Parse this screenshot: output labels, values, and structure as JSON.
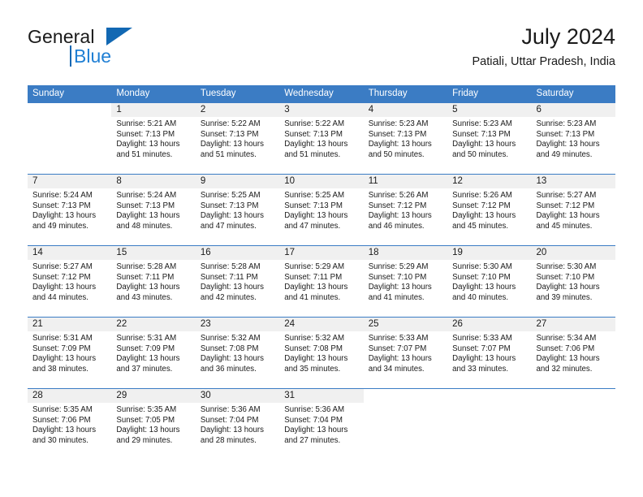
{
  "logo": {
    "primary_text": "General",
    "secondary_text": "Blue",
    "accent_color": "#1268b3",
    "secondary_color": "#1f7fd4",
    "triangle_icon": "triangle-icon"
  },
  "header": {
    "title": "July 2024",
    "subtitle": "Patiali, Uttar Pradesh, India"
  },
  "calendar": {
    "header_color": "#3b7cc4",
    "daynum_band_color": "#f0f0f0",
    "weekdays": [
      "Sunday",
      "Monday",
      "Tuesday",
      "Wednesday",
      "Thursday",
      "Friday",
      "Saturday"
    ],
    "weeks": [
      [
        {
          "day": "",
          "sunrise": "",
          "sunset": "",
          "daylight_line1": "",
          "daylight_line2": ""
        },
        {
          "day": "1",
          "sunrise": "Sunrise: 5:21 AM",
          "sunset": "Sunset: 7:13 PM",
          "daylight_line1": "Daylight: 13 hours",
          "daylight_line2": "and 51 minutes."
        },
        {
          "day": "2",
          "sunrise": "Sunrise: 5:22 AM",
          "sunset": "Sunset: 7:13 PM",
          "daylight_line1": "Daylight: 13 hours",
          "daylight_line2": "and 51 minutes."
        },
        {
          "day": "3",
          "sunrise": "Sunrise: 5:22 AM",
          "sunset": "Sunset: 7:13 PM",
          "daylight_line1": "Daylight: 13 hours",
          "daylight_line2": "and 51 minutes."
        },
        {
          "day": "4",
          "sunrise": "Sunrise: 5:23 AM",
          "sunset": "Sunset: 7:13 PM",
          "daylight_line1": "Daylight: 13 hours",
          "daylight_line2": "and 50 minutes."
        },
        {
          "day": "5",
          "sunrise": "Sunrise: 5:23 AM",
          "sunset": "Sunset: 7:13 PM",
          "daylight_line1": "Daylight: 13 hours",
          "daylight_line2": "and 50 minutes."
        },
        {
          "day": "6",
          "sunrise": "Sunrise: 5:23 AM",
          "sunset": "Sunset: 7:13 PM",
          "daylight_line1": "Daylight: 13 hours",
          "daylight_line2": "and 49 minutes."
        }
      ],
      [
        {
          "day": "7",
          "sunrise": "Sunrise: 5:24 AM",
          "sunset": "Sunset: 7:13 PM",
          "daylight_line1": "Daylight: 13 hours",
          "daylight_line2": "and 49 minutes."
        },
        {
          "day": "8",
          "sunrise": "Sunrise: 5:24 AM",
          "sunset": "Sunset: 7:13 PM",
          "daylight_line1": "Daylight: 13 hours",
          "daylight_line2": "and 48 minutes."
        },
        {
          "day": "9",
          "sunrise": "Sunrise: 5:25 AM",
          "sunset": "Sunset: 7:13 PM",
          "daylight_line1": "Daylight: 13 hours",
          "daylight_line2": "and 47 minutes."
        },
        {
          "day": "10",
          "sunrise": "Sunrise: 5:25 AM",
          "sunset": "Sunset: 7:13 PM",
          "daylight_line1": "Daylight: 13 hours",
          "daylight_line2": "and 47 minutes."
        },
        {
          "day": "11",
          "sunrise": "Sunrise: 5:26 AM",
          "sunset": "Sunset: 7:12 PM",
          "daylight_line1": "Daylight: 13 hours",
          "daylight_line2": "and 46 minutes."
        },
        {
          "day": "12",
          "sunrise": "Sunrise: 5:26 AM",
          "sunset": "Sunset: 7:12 PM",
          "daylight_line1": "Daylight: 13 hours",
          "daylight_line2": "and 45 minutes."
        },
        {
          "day": "13",
          "sunrise": "Sunrise: 5:27 AM",
          "sunset": "Sunset: 7:12 PM",
          "daylight_line1": "Daylight: 13 hours",
          "daylight_line2": "and 45 minutes."
        }
      ],
      [
        {
          "day": "14",
          "sunrise": "Sunrise: 5:27 AM",
          "sunset": "Sunset: 7:12 PM",
          "daylight_line1": "Daylight: 13 hours",
          "daylight_line2": "and 44 minutes."
        },
        {
          "day": "15",
          "sunrise": "Sunrise: 5:28 AM",
          "sunset": "Sunset: 7:11 PM",
          "daylight_line1": "Daylight: 13 hours",
          "daylight_line2": "and 43 minutes."
        },
        {
          "day": "16",
          "sunrise": "Sunrise: 5:28 AM",
          "sunset": "Sunset: 7:11 PM",
          "daylight_line1": "Daylight: 13 hours",
          "daylight_line2": "and 42 minutes."
        },
        {
          "day": "17",
          "sunrise": "Sunrise: 5:29 AM",
          "sunset": "Sunset: 7:11 PM",
          "daylight_line1": "Daylight: 13 hours",
          "daylight_line2": "and 41 minutes."
        },
        {
          "day": "18",
          "sunrise": "Sunrise: 5:29 AM",
          "sunset": "Sunset: 7:10 PM",
          "daylight_line1": "Daylight: 13 hours",
          "daylight_line2": "and 41 minutes."
        },
        {
          "day": "19",
          "sunrise": "Sunrise: 5:30 AM",
          "sunset": "Sunset: 7:10 PM",
          "daylight_line1": "Daylight: 13 hours",
          "daylight_line2": "and 40 minutes."
        },
        {
          "day": "20",
          "sunrise": "Sunrise: 5:30 AM",
          "sunset": "Sunset: 7:10 PM",
          "daylight_line1": "Daylight: 13 hours",
          "daylight_line2": "and 39 minutes."
        }
      ],
      [
        {
          "day": "21",
          "sunrise": "Sunrise: 5:31 AM",
          "sunset": "Sunset: 7:09 PM",
          "daylight_line1": "Daylight: 13 hours",
          "daylight_line2": "and 38 minutes."
        },
        {
          "day": "22",
          "sunrise": "Sunrise: 5:31 AM",
          "sunset": "Sunset: 7:09 PM",
          "daylight_line1": "Daylight: 13 hours",
          "daylight_line2": "and 37 minutes."
        },
        {
          "day": "23",
          "sunrise": "Sunrise: 5:32 AM",
          "sunset": "Sunset: 7:08 PM",
          "daylight_line1": "Daylight: 13 hours",
          "daylight_line2": "and 36 minutes."
        },
        {
          "day": "24",
          "sunrise": "Sunrise: 5:32 AM",
          "sunset": "Sunset: 7:08 PM",
          "daylight_line1": "Daylight: 13 hours",
          "daylight_line2": "and 35 minutes."
        },
        {
          "day": "25",
          "sunrise": "Sunrise: 5:33 AM",
          "sunset": "Sunset: 7:07 PM",
          "daylight_line1": "Daylight: 13 hours",
          "daylight_line2": "and 34 minutes."
        },
        {
          "day": "26",
          "sunrise": "Sunrise: 5:33 AM",
          "sunset": "Sunset: 7:07 PM",
          "daylight_line1": "Daylight: 13 hours",
          "daylight_line2": "and 33 minutes."
        },
        {
          "day": "27",
          "sunrise": "Sunrise: 5:34 AM",
          "sunset": "Sunset: 7:06 PM",
          "daylight_line1": "Daylight: 13 hours",
          "daylight_line2": "and 32 minutes."
        }
      ],
      [
        {
          "day": "28",
          "sunrise": "Sunrise: 5:35 AM",
          "sunset": "Sunset: 7:06 PM",
          "daylight_line1": "Daylight: 13 hours",
          "daylight_line2": "and 30 minutes."
        },
        {
          "day": "29",
          "sunrise": "Sunrise: 5:35 AM",
          "sunset": "Sunset: 7:05 PM",
          "daylight_line1": "Daylight: 13 hours",
          "daylight_line2": "and 29 minutes."
        },
        {
          "day": "30",
          "sunrise": "Sunrise: 5:36 AM",
          "sunset": "Sunset: 7:04 PM",
          "daylight_line1": "Daylight: 13 hours",
          "daylight_line2": "and 28 minutes."
        },
        {
          "day": "31",
          "sunrise": "Sunrise: 5:36 AM",
          "sunset": "Sunset: 7:04 PM",
          "daylight_line1": "Daylight: 13 hours",
          "daylight_line2": "and 27 minutes."
        },
        {
          "day": "",
          "sunrise": "",
          "sunset": "",
          "daylight_line1": "",
          "daylight_line2": ""
        },
        {
          "day": "",
          "sunrise": "",
          "sunset": "",
          "daylight_line1": "",
          "daylight_line2": ""
        },
        {
          "day": "",
          "sunrise": "",
          "sunset": "",
          "daylight_line1": "",
          "daylight_line2": ""
        }
      ]
    ]
  }
}
